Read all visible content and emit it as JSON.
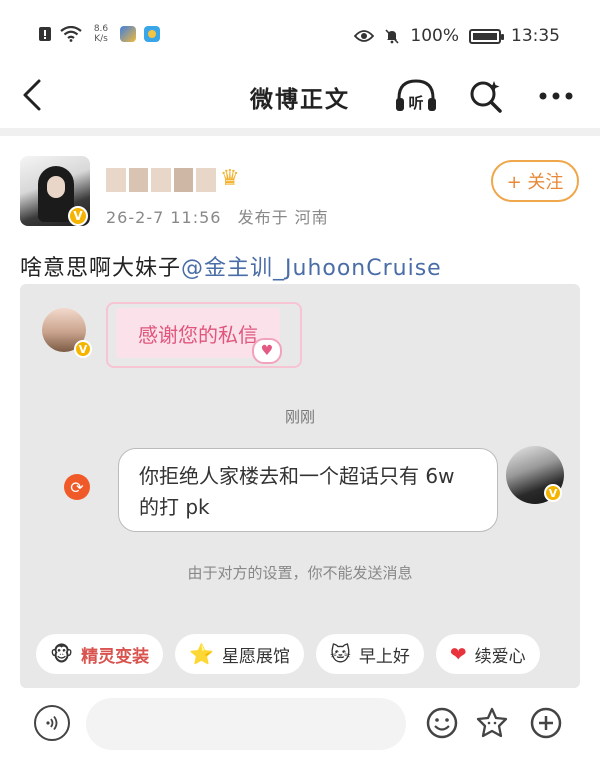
{
  "status_bar": {
    "net_speed_value": "8.6",
    "net_speed_unit": "K/s",
    "battery": "100%",
    "time": "13:35"
  },
  "nav": {
    "title": "微博正文",
    "listen_label": "听"
  },
  "post": {
    "timestamp": "26-2-7 11:56",
    "location": "发布于 河南",
    "follow_label": "+ 关注",
    "text": "啥意思啊大妹子",
    "mention": "@金主训_JuhoonCruise"
  },
  "chat": {
    "thanks_message": "感谢您的私信",
    "time_label": "刚刚",
    "message_line1": "你拒绝人家楼去和一个超话只有 6w",
    "message_line2": "的打 pk",
    "notice": "由于对方的设置，你不能发送消息",
    "chips": [
      {
        "icon": "🐵",
        "label": "精灵变装"
      },
      {
        "icon": "⭐",
        "label": "星愿展馆"
      },
      {
        "icon": "🐱",
        "label": "早上好"
      },
      {
        "icon": "❤",
        "label": "续爱心"
      }
    ]
  },
  "colors": {
    "accent_orange": "#f0a64a",
    "mention_blue": "#4a6da7",
    "pink_text": "#e0567d"
  }
}
